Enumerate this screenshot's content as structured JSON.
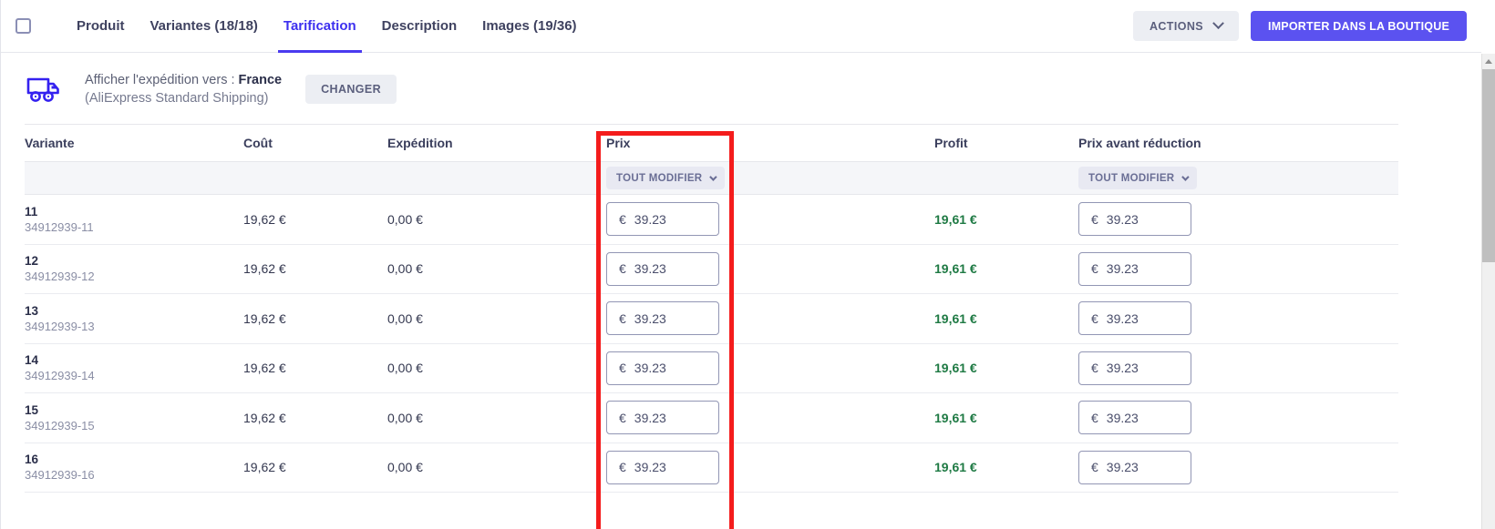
{
  "tabbar": {
    "select_all_checkbox": "",
    "tabs": [
      {
        "label": "Produit",
        "active": false
      },
      {
        "label": "Variantes (18/18)",
        "active": false
      },
      {
        "label": "Tarification",
        "active": true
      },
      {
        "label": "Description",
        "active": false
      },
      {
        "label": "Images (19/36)",
        "active": false
      }
    ],
    "actions_label": "ACTIONS",
    "import_label": "IMPORTER DANS LA BOUTIQUE"
  },
  "shipping": {
    "icon": "delivery-truck-icon",
    "label_prefix": "Afficher l'expédition vers :",
    "country": "France",
    "carrier": "(AliExpress Standard Shipping)",
    "change_label": "CHANGER"
  },
  "table": {
    "headers": {
      "variant": "Variante",
      "cost": "Coût",
      "shipping": "Expédition",
      "price": "Prix",
      "profit": "Profit",
      "compare_price": "Prix avant réduction"
    },
    "bulk_edit_price_label": "TOUT MODIFIER",
    "bulk_edit_compare_label": "TOUT MODIFIER",
    "currency_symbol": "€",
    "rows": [
      {
        "variant": "11",
        "sku": "34912939-11",
        "cost": "19,62 €",
        "shipping": "0,00 €",
        "price": "39.23",
        "profit": "19,61 €",
        "compare_price": "39.23"
      },
      {
        "variant": "12",
        "sku": "34912939-12",
        "cost": "19,62 €",
        "shipping": "0,00 €",
        "price": "39.23",
        "profit": "19,61 €",
        "compare_price": "39.23"
      },
      {
        "variant": "13",
        "sku": "34912939-13",
        "cost": "19,62 €",
        "shipping": "0,00 €",
        "price": "39.23",
        "profit": "19,61 €",
        "compare_price": "39.23"
      },
      {
        "variant": "14",
        "sku": "34912939-14",
        "cost": "19,62 €",
        "shipping": "0,00 €",
        "price": "39.23",
        "profit": "19,61 €",
        "compare_price": "39.23"
      },
      {
        "variant": "15",
        "sku": "34912939-15",
        "cost": "19,62 €",
        "shipping": "0,00 €",
        "price": "39.23",
        "profit": "19,61 €",
        "compare_price": "39.23"
      },
      {
        "variant": "16",
        "sku": "34912939-16",
        "cost": "19,62 €",
        "shipping": "0,00 €",
        "price": "39.23",
        "profit": "19,61 €",
        "compare_price": "39.23"
      }
    ]
  },
  "annotation": {
    "type": "highlight-rectangle",
    "color": "#f41c1c",
    "target": "price-column"
  },
  "colors": {
    "accent": "#5b52f0",
    "active_tab": "#3d30ef",
    "profit_green": "#1f7a44",
    "highlight_red": "#f41c1c",
    "muted_text": "#8a8ea5"
  }
}
